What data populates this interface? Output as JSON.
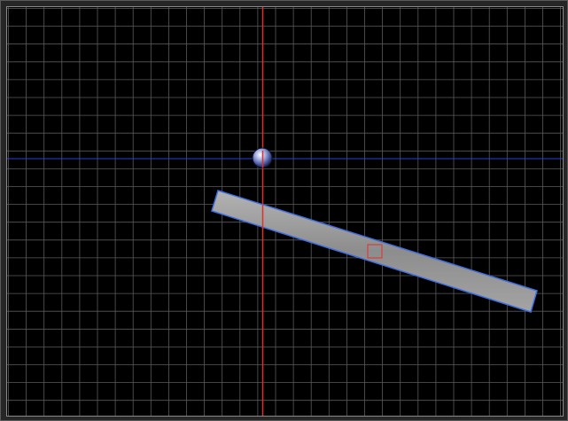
{
  "scene": {
    "background": "#000000",
    "grid_color": "#5a5a5a",
    "frame_color": "#2a2a2a",
    "vertical_axis_color": "#e0302a",
    "horizontal_axis_color": "#2a3fd8",
    "plank_fill": "#9a9a9a",
    "plank_outline": "#3f6fe0",
    "marker_color": "#e0302a",
    "ball_color": "#7d8fd0"
  },
  "objects": {
    "ball": {
      "icon": "sphere-icon"
    },
    "plank": {
      "icon": "beam-icon",
      "rotation_deg": 17
    },
    "pivot_marker": {
      "icon": "square-marker-icon"
    }
  }
}
